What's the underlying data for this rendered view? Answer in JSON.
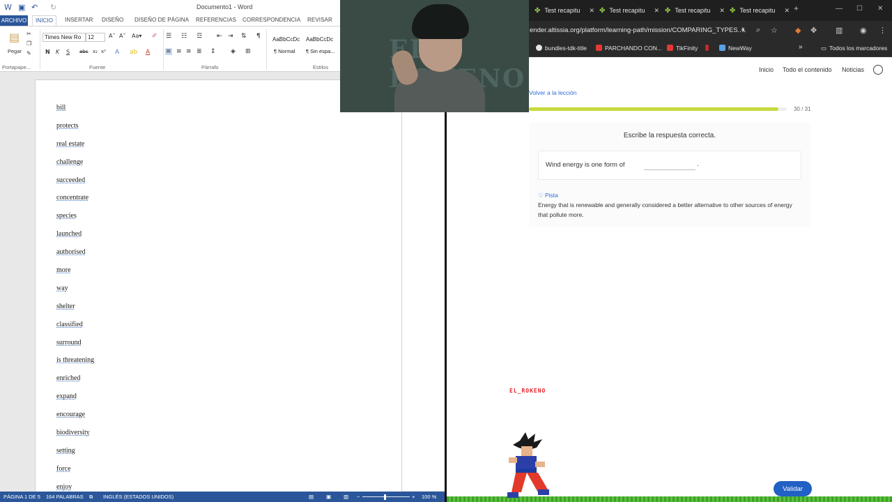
{
  "word": {
    "window_title": "Documento1 - Word",
    "tabs": [
      "ARCHIVO",
      "INICIO",
      "INSERTAR",
      "DISEÑO",
      "DISEÑO DE PÁGINA",
      "REFERENCIAS",
      "CORRESPONDENCIA",
      "REVISAR"
    ],
    "active_tab": "INICIO",
    "ribbon": {
      "paste_label": "Pegar",
      "font_name": "Times New Ro",
      "font_size": "12",
      "style_normal": "¶ Normal",
      "style_nospacing": "¶ Sin espa...",
      "style_preview": "AaBbCcDc",
      "groups": {
        "clipboard": "Portapape...",
        "font": "Fuente",
        "paragraph": "Párrafo",
        "styles": "Estilos"
      }
    },
    "words": [
      "bill",
      "protects",
      "real estate",
      "challenge",
      "succeeded",
      "concentrate",
      "species",
      "launched",
      "authorised",
      "more",
      "way",
      "shelter",
      "classified",
      "surround",
      "is threatening",
      "enriched",
      "expand",
      "encourage",
      "biodiversity",
      "setting",
      "force",
      "enjoy"
    ],
    "status": {
      "page": "PÁGINA 1 DE 5",
      "words": "164 PALABRAS",
      "language": "INGLÉS (ESTADOS UNIDOS)",
      "zoom": "100 %"
    }
  },
  "webcam": {
    "background_text": "EL ROKENO"
  },
  "browser": {
    "tabs": [
      {
        "label": "Test recapitu",
        "close": "✕"
      },
      {
        "label": "Test recapitu",
        "close": "✕"
      },
      {
        "label": "Test recapitu",
        "close": "✕"
      },
      {
        "label": "Test recapitu",
        "close": "✕"
      }
    ],
    "new_tab": "+",
    "url": "ender.altissia.org/platform/learning-path/mission/COMPARING_TYPES...",
    "bookmarks": [
      {
        "label": "bundles-tdk-title",
        "color": "#e5e5e5"
      },
      {
        "label": "PARCHANDO CON...",
        "color": "#e53935"
      },
      {
        "label": "TikFinity",
        "color": "#e53935"
      },
      {
        "label": "",
        "color": "#c62828"
      },
      {
        "label": "NewWay",
        "color": "#5aa0e6"
      }
    ],
    "bookmarks_more": "»",
    "all_bookmarks": "Todos los marcadores"
  },
  "site": {
    "nav": [
      "Inicio",
      "Todo el contenido",
      "Noticias"
    ],
    "back_link": "Volver a la lección",
    "progress": {
      "current": 30,
      "total": 31,
      "label": "30 / 31"
    },
    "prompt": "Escribe la respuesta correcta.",
    "question": "Wind energy is one form of",
    "question_end": ".",
    "answer_placeholder": "",
    "hint_title": "Pista",
    "hint_text": "Energy that is renewable and generally considered a better alternative to other sources of energy that pollute more.",
    "validate_button": "Validar"
  },
  "overlay": {
    "game_tag": "EL_ROKENO"
  }
}
